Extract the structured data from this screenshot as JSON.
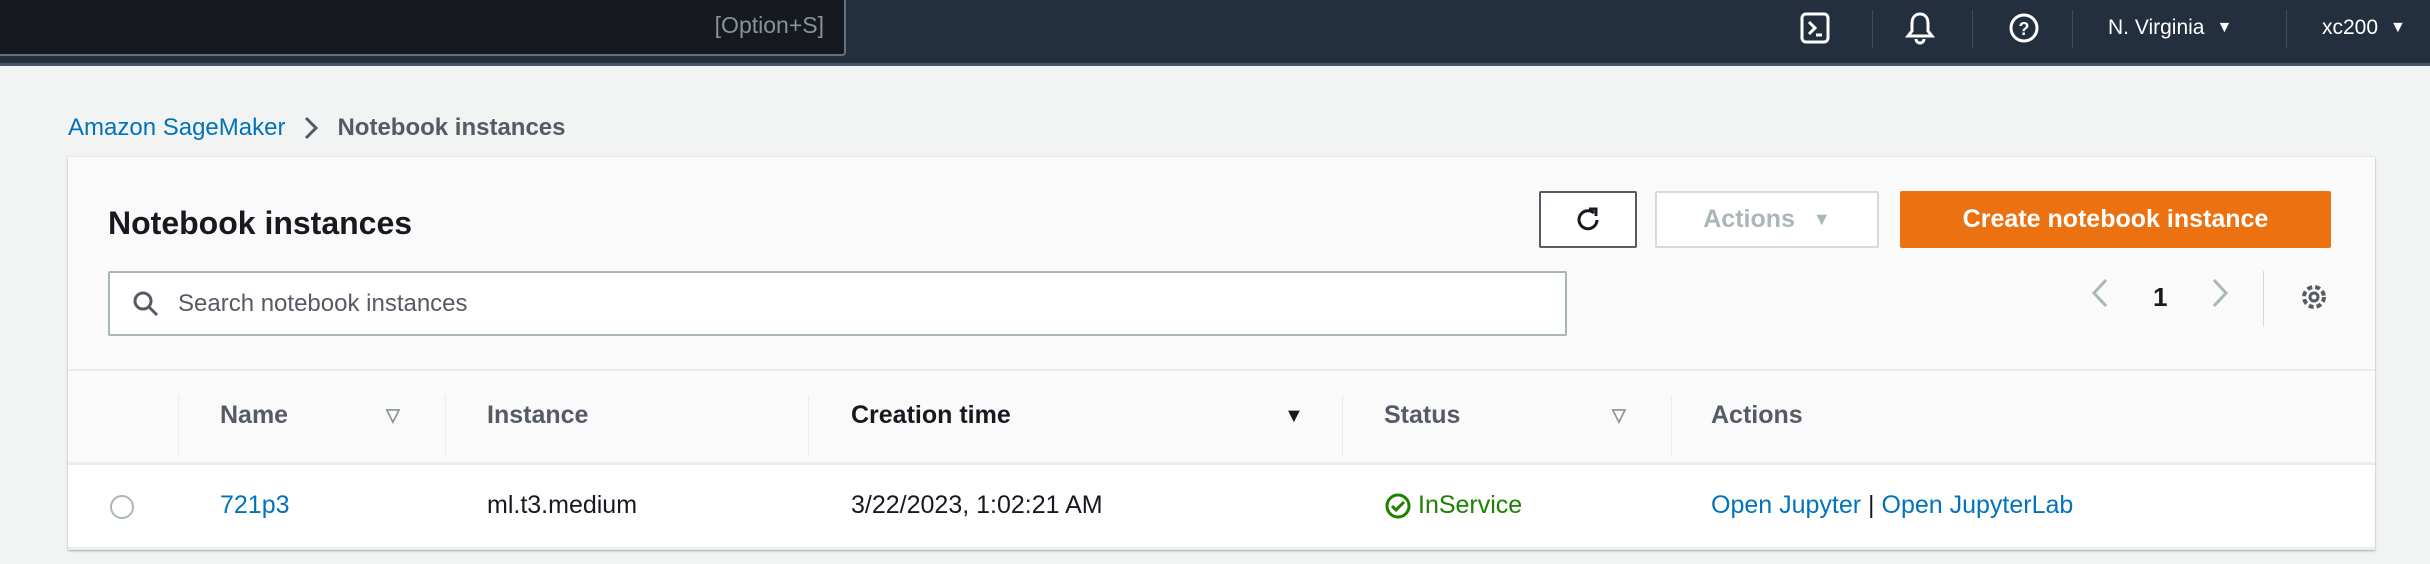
{
  "topbar": {
    "search_shortcut": "[Option+S]",
    "region": "N. Virginia",
    "user": "xc200"
  },
  "breadcrumb": {
    "parent": "Amazon SageMaker",
    "current": "Notebook instances"
  },
  "panel": {
    "title": "Notebook instances",
    "actions_label": "Actions",
    "create_label": "Create notebook instance",
    "search_placeholder": "Search notebook instances",
    "page": "1"
  },
  "table": {
    "columns": [
      "Name",
      "Instance",
      "Creation time",
      "Status",
      "Actions"
    ],
    "rows": [
      {
        "name": "721p3",
        "instance": "ml.t3.medium",
        "created": "3/22/2023, 1:02:21 AM",
        "status": "InService",
        "action1": "Open Jupyter",
        "sep": "|",
        "action2": "Open JupyterLab"
      }
    ]
  },
  "colors": {
    "accent": "#ec7211",
    "link": "#0073bb",
    "success": "#1d8102",
    "topbar": "#232f3e"
  }
}
